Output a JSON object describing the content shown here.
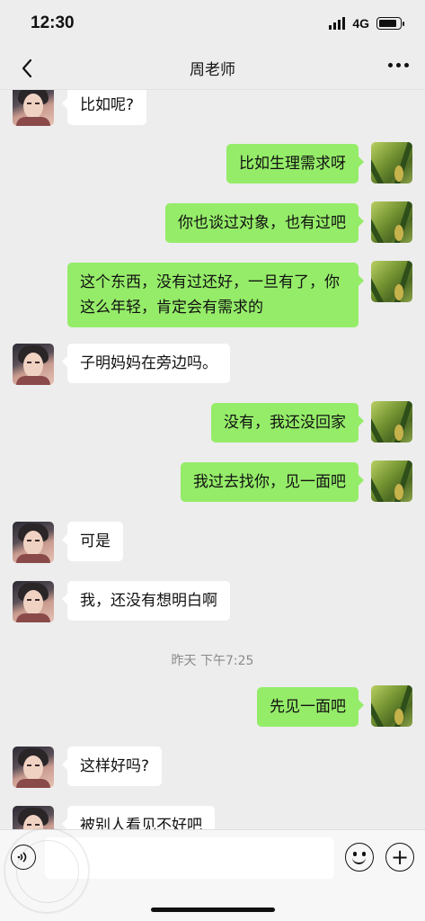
{
  "status_bar": {
    "time": "12:30",
    "network": "4G",
    "battery_level": 0.85
  },
  "header": {
    "title": "周老师"
  },
  "messages": [
    {
      "side": "in",
      "text": "比如呢?"
    },
    {
      "side": "out",
      "text": "比如生理需求呀"
    },
    {
      "side": "out",
      "text": "你也谈过对象，也有过吧"
    },
    {
      "side": "out",
      "text": "这个东西，没有过还好，一旦有了，你这么年轻，肯定会有需求的"
    },
    {
      "side": "in",
      "text": "子明妈妈在旁边吗。"
    },
    {
      "side": "out",
      "text": "没有，我还没回家"
    },
    {
      "side": "out",
      "text": "我过去找你，见一面吧"
    },
    {
      "side": "in",
      "text": "可是"
    },
    {
      "side": "in",
      "text": "我，还没有想明白啊"
    },
    {
      "side": "out",
      "text": "先见一面吧"
    },
    {
      "side": "in",
      "text": "这样好吗?"
    },
    {
      "side": "in",
      "text": "被别人看见不好吧"
    }
  ],
  "timestamp": "昨天 下午7:25",
  "input_bar": {
    "text_value": ""
  },
  "colors": {
    "outgoing_bubble": "#95ec69",
    "incoming_bubble": "#ffffff",
    "background": "#ededed"
  }
}
